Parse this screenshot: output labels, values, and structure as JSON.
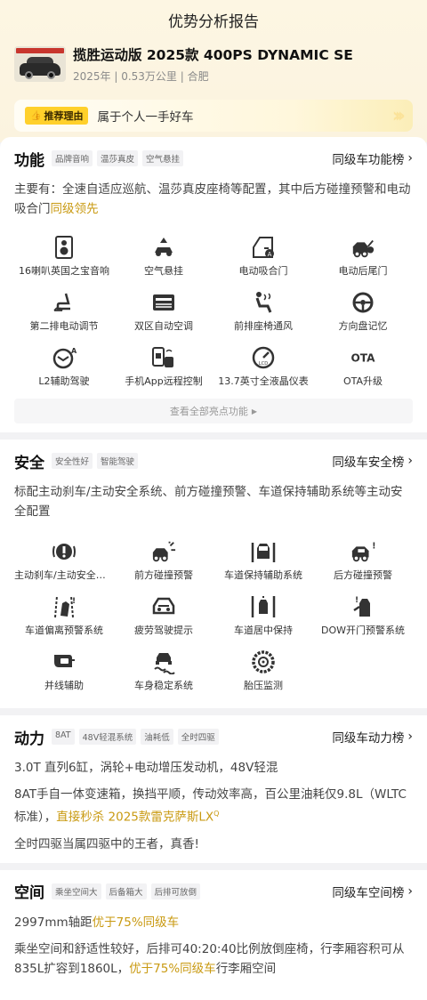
{
  "header": {
    "title": "优势分析报告"
  },
  "car": {
    "name": "揽胜运动版 2025款 400PS DYNAMIC SE",
    "meta": "2025年 | 0.53万公里 | 合肥"
  },
  "reason": {
    "tag": "推荐理由",
    "text": "属于个人一手好车"
  },
  "function": {
    "title": "功能",
    "tags": [
      "品牌音响",
      "温莎真皮",
      "空气悬挂"
    ],
    "rank": "同级车功能榜",
    "desc_plain": "主要有：全速自适应巡航、温莎真皮座椅等配置，其中后方碰撞预警和电动吸合门",
    "desc_hl": "同级领先",
    "features": [
      {
        "label": "16喇叭英国之宝音响",
        "icon": "speaker-icon"
      },
      {
        "label": "空气悬挂",
        "icon": "air-suspension-icon"
      },
      {
        "label": "电动吸合门",
        "icon": "soft-close-door-icon"
      },
      {
        "label": "电动后尾门",
        "icon": "power-tailgate-icon"
      },
      {
        "label": "第二排电动调节",
        "icon": "seat-adjust-icon"
      },
      {
        "label": "双区自动空调",
        "icon": "climate-control-icon"
      },
      {
        "label": "前排座椅通风",
        "icon": "seat-ventilation-icon"
      },
      {
        "label": "方向盘记忆",
        "icon": "steering-memory-icon"
      },
      {
        "label": "L2辅助驾驶",
        "icon": "assisted-driving-icon"
      },
      {
        "label": "手机App远程控制",
        "icon": "remote-app-icon"
      },
      {
        "label": "13.7英寸全液晶仪表",
        "icon": "lcd-cluster-icon"
      },
      {
        "label": "OTA升级",
        "icon": "ota-icon"
      }
    ],
    "more": "查看全部亮点功能"
  },
  "safety": {
    "title": "安全",
    "tags": [
      "安全性好",
      "智能驾驶"
    ],
    "rank": "同级车安全榜",
    "desc": "标配主动刹车/主动安全系统、前方碰撞预警、车道保持辅助系统等主动安全配置",
    "features": [
      {
        "label": "主动刹车/主动安全系统",
        "icon": "auto-brake-icon"
      },
      {
        "label": "前方碰撞预警",
        "icon": "forward-collision-icon"
      },
      {
        "label": "车道保持辅助系统",
        "icon": "lane-keep-icon"
      },
      {
        "label": "后方碰撞预警",
        "icon": "rear-collision-icon"
      },
      {
        "label": "车道偏离预警系统",
        "icon": "lane-departure-icon"
      },
      {
        "label": "疲劳驾驶提示",
        "icon": "fatigue-icon"
      },
      {
        "label": "车道居中保持",
        "icon": "lane-center-icon"
      },
      {
        "label": "DOW开门预警系统",
        "icon": "door-open-warning-icon"
      },
      {
        "label": "并线辅助",
        "icon": "blind-spot-icon"
      },
      {
        "label": "车身稳定系统",
        "icon": "stability-icon"
      },
      {
        "label": "胎压监测",
        "icon": "tire-pressure-icon"
      }
    ]
  },
  "power": {
    "title": "动力",
    "tags": [
      "8AT",
      "48V轻混系统",
      "油耗低",
      "全时四驱"
    ],
    "rank": "同级车动力榜",
    "p1": "3.0T 直列6缸，涡轮+电动增压发动机，48V轻混",
    "p2_plain": "8AT手自一体变速箱，换挡平顺，传动效率高，百公里油耗仅9.8L（WLTC标准），",
    "p2_hl": "直接秒杀 2025款雷克萨斯LX",
    "p2_sup": "Q",
    "p3": "全时四驱当属四驱中的王者，真香!"
  },
  "space": {
    "title": "空间",
    "tags": [
      "乘坐空间大",
      "后备箱大",
      "后排可放倒"
    ],
    "rank": "同级车空间榜",
    "p1_plain": "2997mm轴距",
    "p1_hl": "优于75%同级车",
    "p2_plain": "乘坐空间和舒适性较好，后排可40:20:40比例放倒座椅，行李厢容积可从835L扩容到1860L，",
    "p2_hl": "优于75%同级车",
    "p2_tail": "行李厢空间"
  },
  "colors": {
    "highlight": "#c99a12",
    "hero_bg": "#fdf6e3",
    "tag_yellow": "#ffd02b"
  }
}
